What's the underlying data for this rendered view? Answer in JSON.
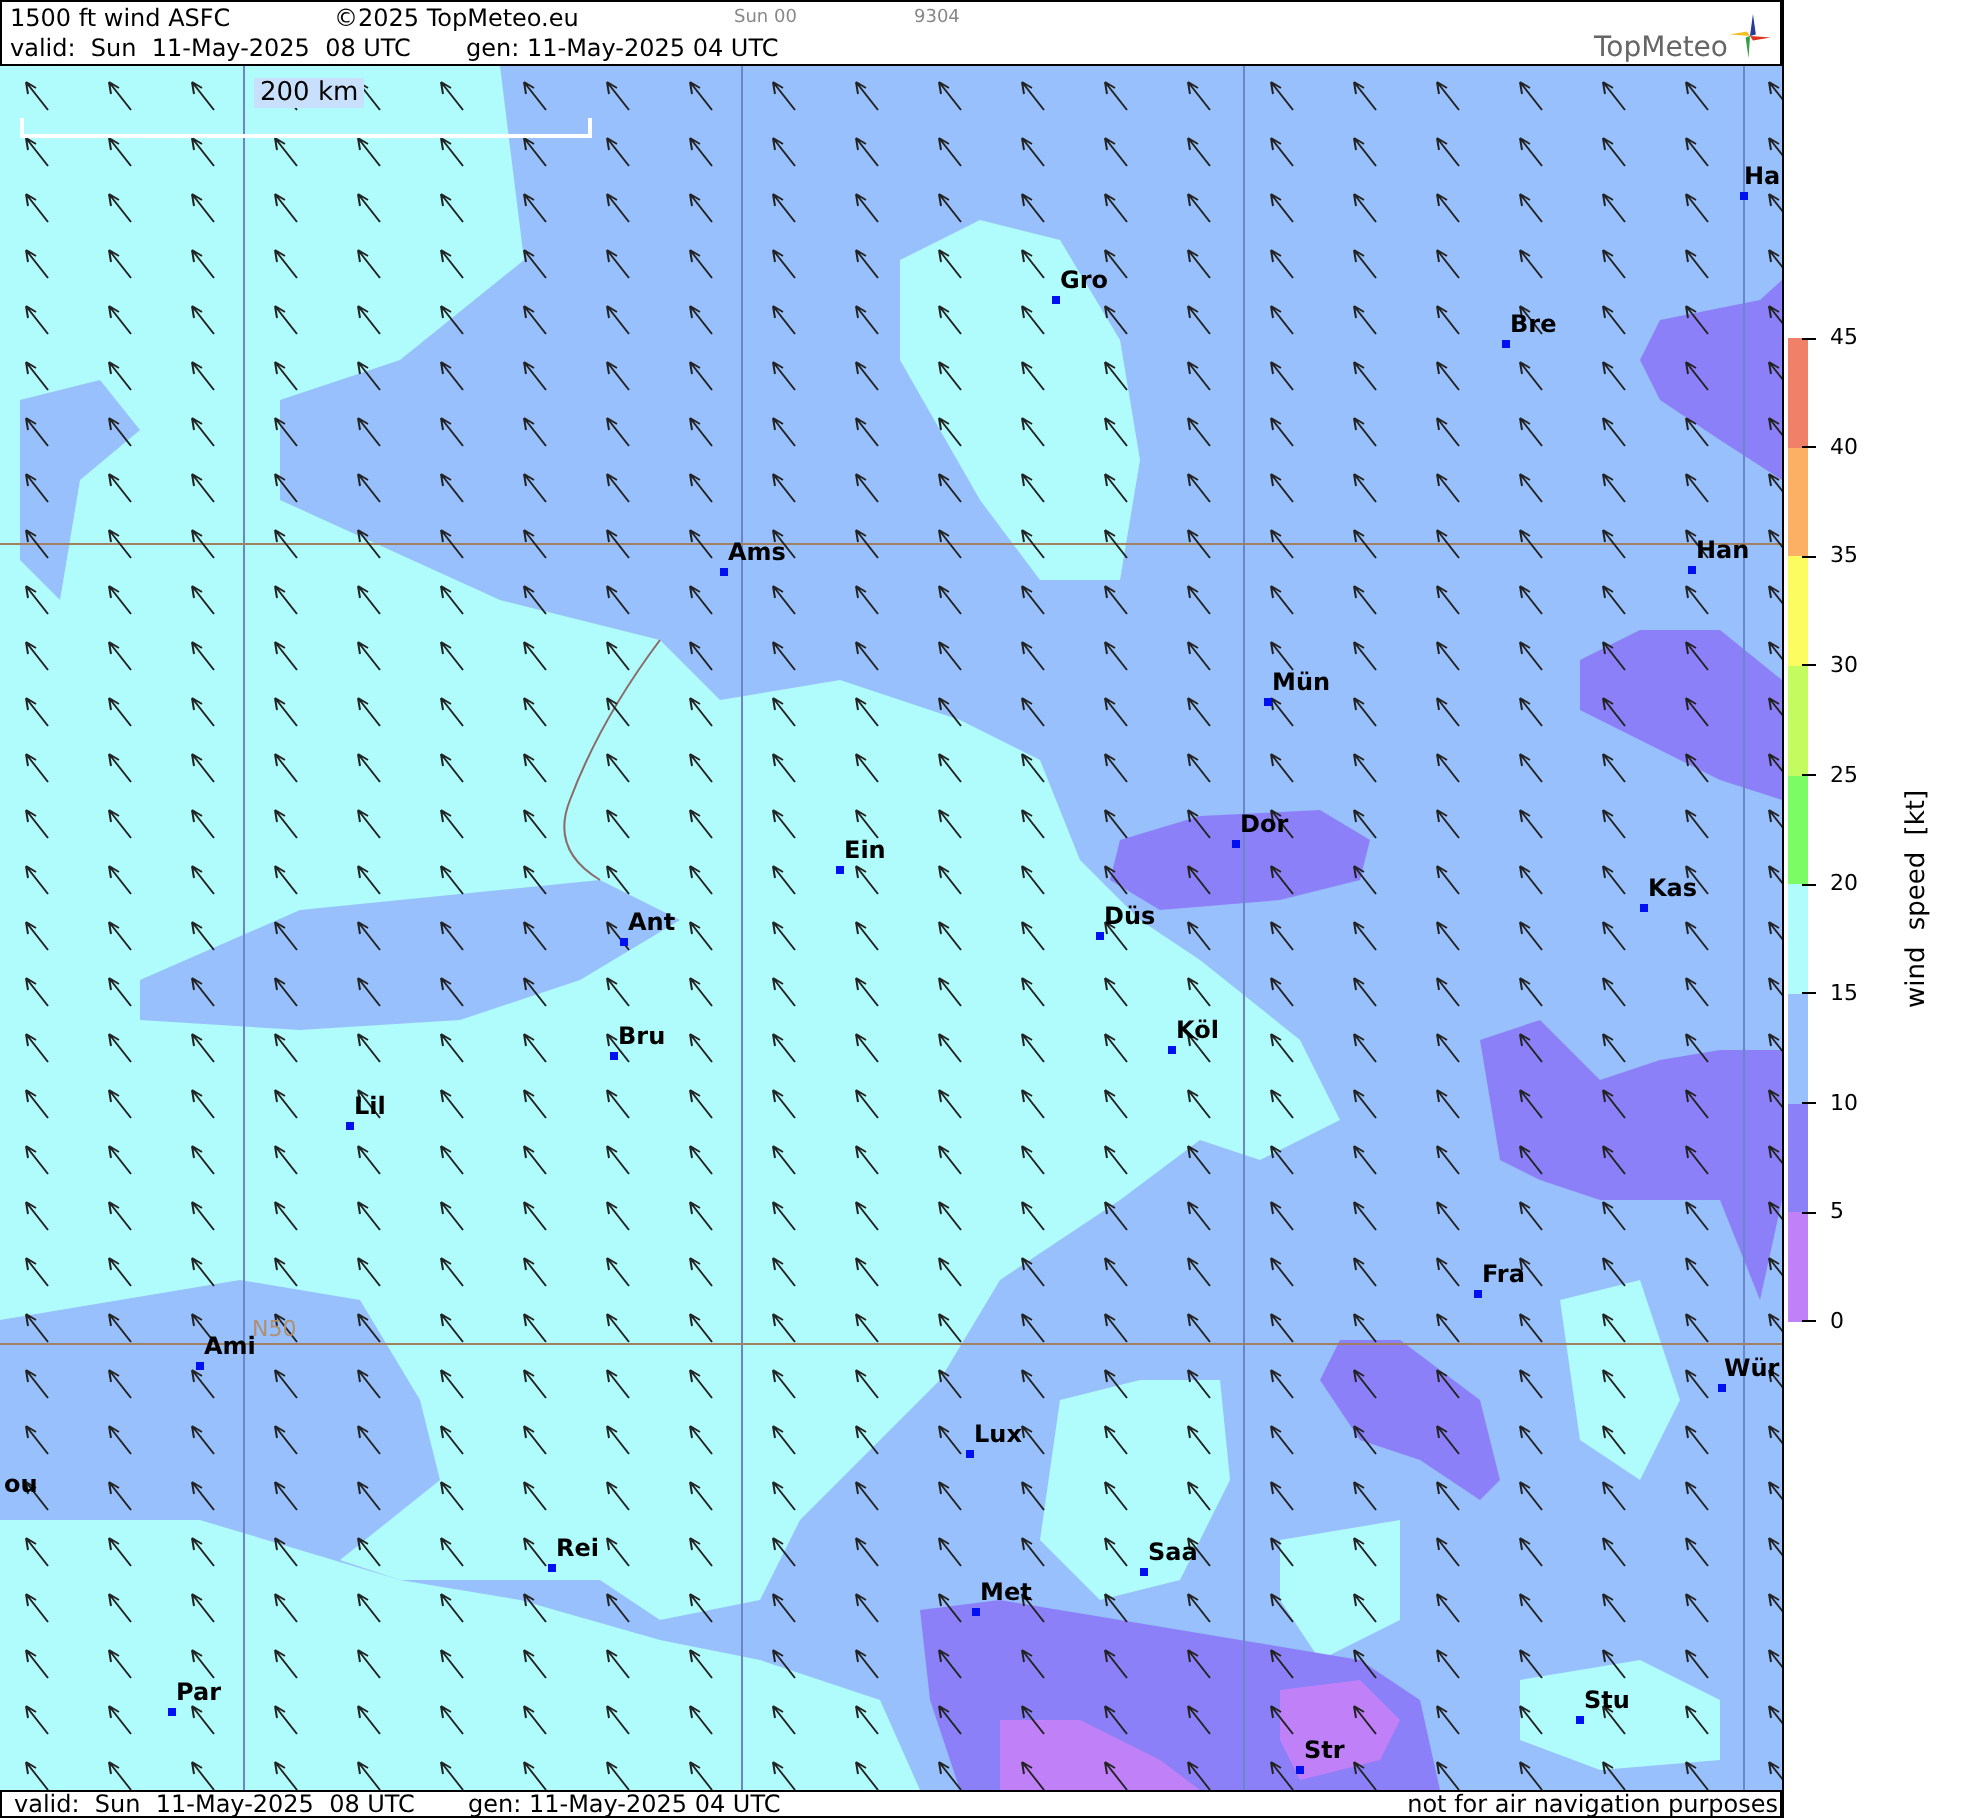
{
  "header": {
    "title": "1500 ft wind ASFC",
    "copyright": "©2025 TopMeteo.eu",
    "run_label": "Sun 00",
    "code": "9304",
    "valid": "valid:  Sun  11-May-2025  08 UTC",
    "generated": "gen: 11-May-2025 04 UTC",
    "logo": "TopMeteo"
  },
  "map": {
    "scale_label": "200 km",
    "grid_label": "N50",
    "cities": [
      {
        "name": "Ha"
      },
      {
        "name": "Gro"
      },
      {
        "name": "Bre"
      },
      {
        "name": "Ams"
      },
      {
        "name": "Han"
      },
      {
        "name": "Mün"
      },
      {
        "name": "Dor"
      },
      {
        "name": "Ein"
      },
      {
        "name": "Kas"
      },
      {
        "name": "Düs"
      },
      {
        "name": "Ant"
      },
      {
        "name": "Bru"
      },
      {
        "name": "Köl"
      },
      {
        "name": "Lil"
      },
      {
        "name": "Fra"
      },
      {
        "name": "Ami"
      },
      {
        "name": "Wür"
      },
      {
        "name": "Lux"
      },
      {
        "name": "ou"
      },
      {
        "name": "Rei"
      },
      {
        "name": "Saa"
      },
      {
        "name": "Met"
      },
      {
        "name": "Par"
      },
      {
        "name": "Stu"
      },
      {
        "name": "Str"
      }
    ]
  },
  "legend": {
    "title": "wind speed [kt]",
    "ticks": [
      "45",
      "40",
      "35",
      "30",
      "25",
      "20",
      "15",
      "10",
      "5",
      "0"
    ],
    "bands": [
      {
        "color": "#f08068"
      },
      {
        "color": "#fcb064"
      },
      {
        "color": "#fcfc60"
      },
      {
        "color": "#c4fc60"
      },
      {
        "color": "#7cfc64"
      },
      {
        "color": "#b0fcfc"
      },
      {
        "color": "#98c0fc"
      },
      {
        "color": "#8c80f8"
      },
      {
        "color": "#c080f8"
      }
    ]
  },
  "footer": {
    "valid": "valid:  Sun  11-May-2025  08 UTC",
    "generated": "gen: 11-May-2025 04 UTC",
    "disclaimer": "not for air navigation purposes"
  }
}
